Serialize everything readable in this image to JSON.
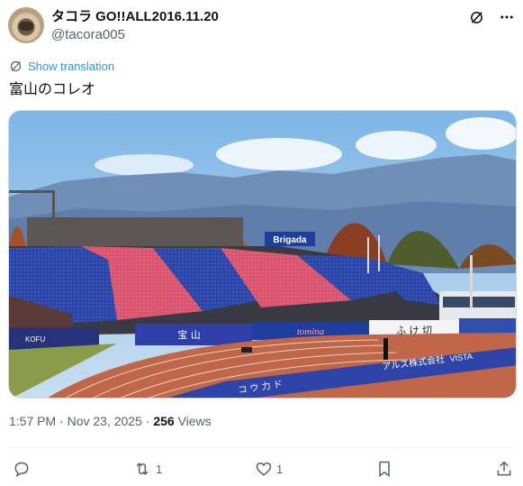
{
  "tweet": {
    "display_name": "タコラ GO!!ALL2016.11.20",
    "handle": "@tacora005",
    "translate_label": "Show translation",
    "text": "富山のコレオ",
    "time": "1:57 PM",
    "date": "Nov 23, 2025",
    "separator": "·",
    "views_count": "256",
    "views_label": "Views"
  },
  "photo": {
    "banner_text": "Brigada",
    "ad_board_1": "KOFU",
    "ad_board_2": "宝 山",
    "ad_board_3": "tomina",
    "ad_board_4": "ふ け 切",
    "ad_board_5": "アルズ株式会社",
    "ad_board_6": "VISTA",
    "ad_board_7": "コ ウ 力 ド"
  },
  "actions": {
    "reply_count": "",
    "retweet_count": "1",
    "like_count": "1"
  },
  "colors": {
    "accent": "#1d9bf0",
    "muted": "#536471",
    "text": "#0f1419",
    "border": "#cfd9de"
  },
  "icons": {
    "grok": "grok-icon",
    "more": "more-dots-icon",
    "translate": "translate-icon",
    "reply": "reply-icon",
    "retweet": "retweet-icon",
    "like": "heart-icon",
    "bookmark": "bookmark-icon",
    "share": "share-icon"
  }
}
